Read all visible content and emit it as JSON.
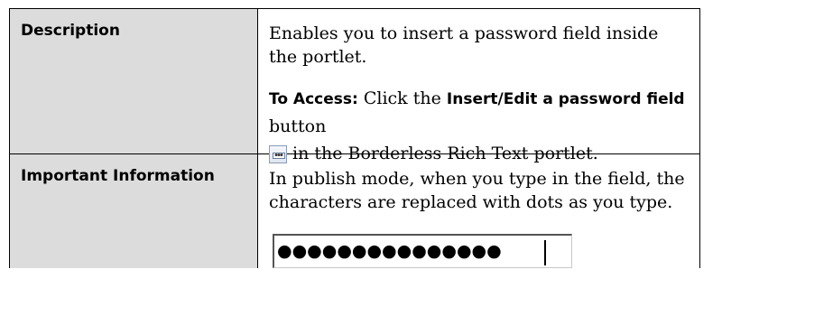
{
  "rows": {
    "description": {
      "label": "Description",
      "text": "Enables you to insert a password field inside the portlet.",
      "access": {
        "label": "To Access:",
        "before_button": " Click the ",
        "button_name": "Insert/Edit a password field",
        "after_button": " button",
        "icon": "password-field-icon",
        "after_icon": "in the Borderless Rich Text portlet."
      }
    },
    "important": {
      "label": "Important Information",
      "text": "In publish mode, when you type in the field, the characters are replaced with dots as you type.",
      "password_value": "●●●●●●●●●●●●●●●"
    }
  }
}
